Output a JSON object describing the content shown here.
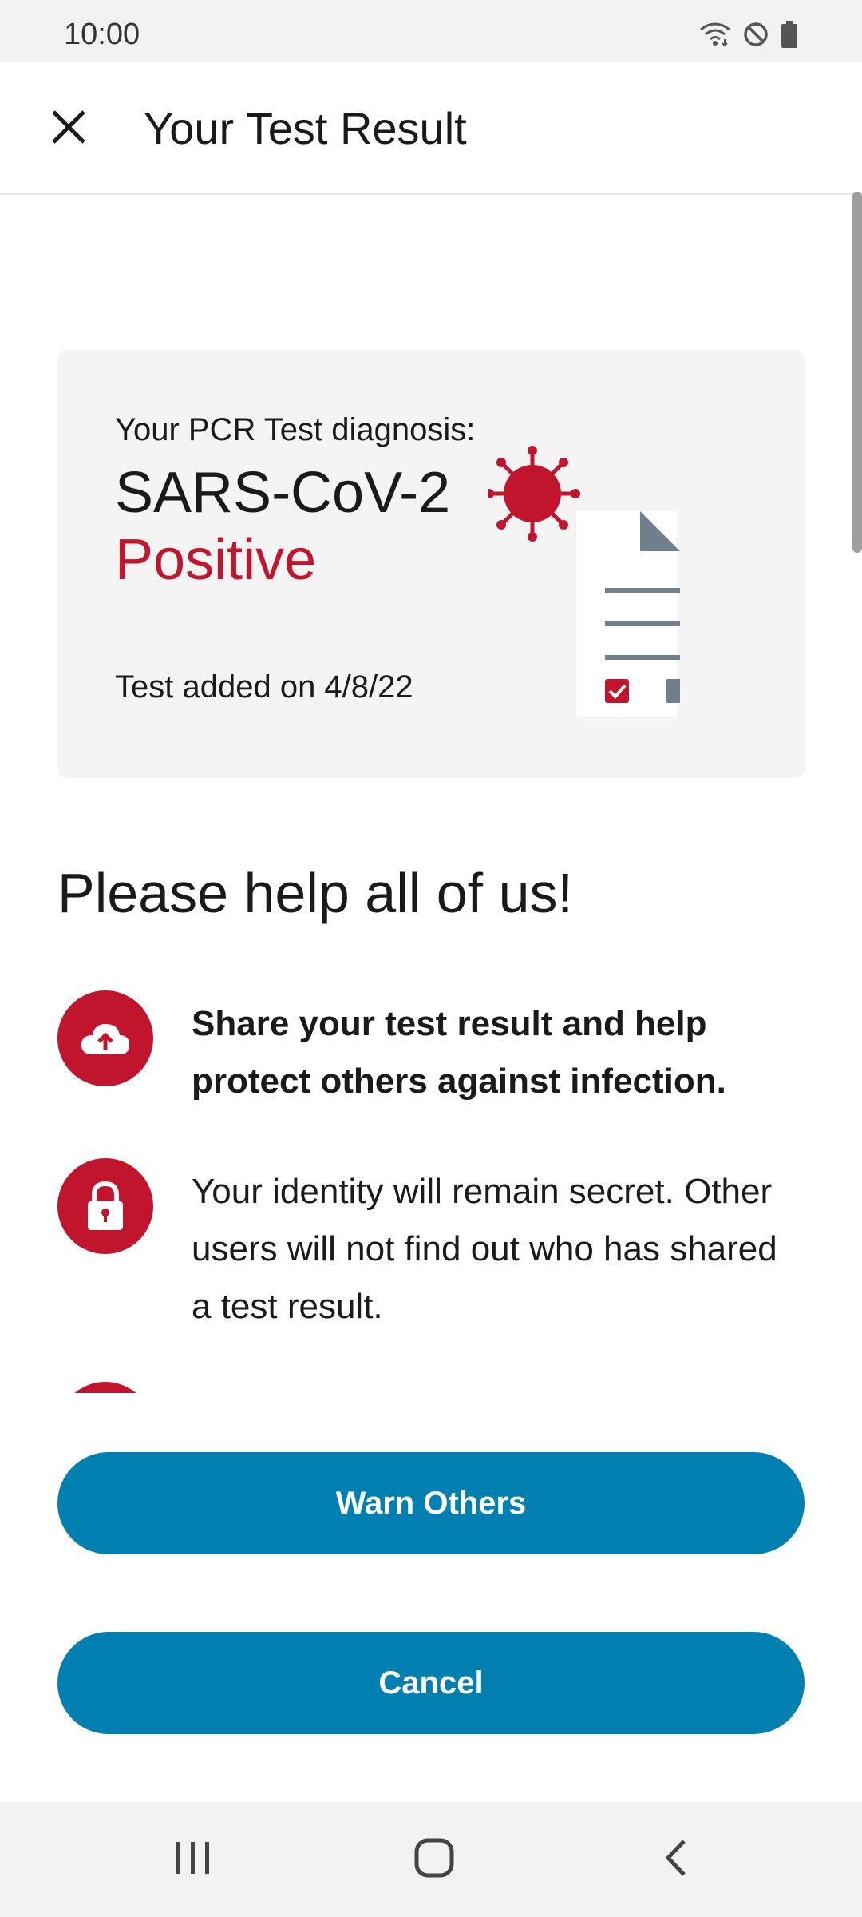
{
  "status_bar": {
    "time": "10:00",
    "icons": [
      "wifi-icon",
      "do-not-disturb-icon",
      "battery-icon"
    ]
  },
  "app_bar": {
    "title": "Your Test Result",
    "close_icon": "close-icon"
  },
  "result_card": {
    "label": "Your PCR Test diagnosis:",
    "diagnosis": "SARS-CoV-2",
    "status": "Positive",
    "date_text": "Test added on 4/8/22"
  },
  "help": {
    "title": "Please help all of us!",
    "items": [
      {
        "icon": "cloud-upload-icon",
        "text": "Share your test result and help protect others against infection."
      },
      {
        "icon": "lock-icon",
        "text": "Your identity will remain secret. Other users will not find out who has shared a test result."
      }
    ]
  },
  "buttons": {
    "warn": "Warn Others",
    "cancel": "Cancel"
  },
  "nav": {
    "icons": [
      "recent-apps-icon",
      "home-icon",
      "back-icon"
    ]
  },
  "colors": {
    "accent_red": "#c1152d",
    "button_blue": "#0080b0",
    "card_bg": "#f4f4f4"
  }
}
